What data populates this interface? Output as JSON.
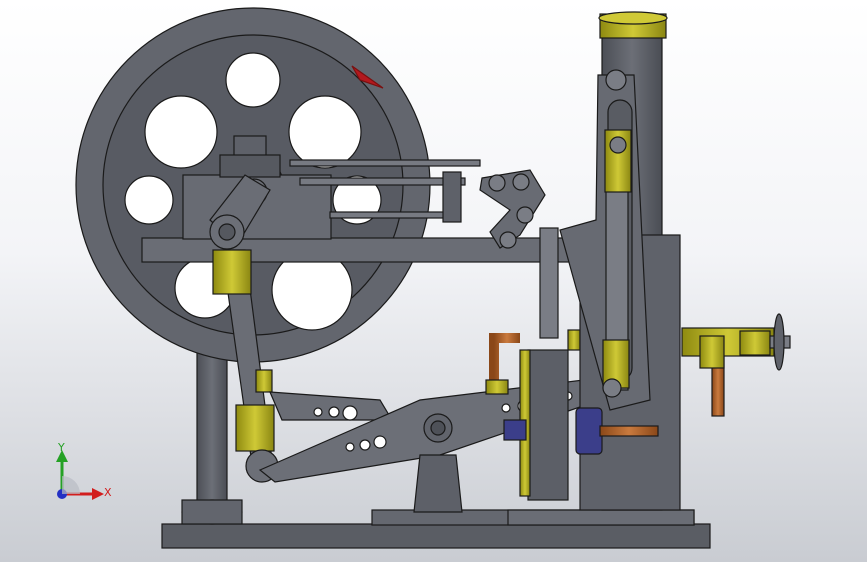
{
  "viewport": {
    "background_top": "#ffffff",
    "background_bottom": "#c9ccd2"
  },
  "model": {
    "description_parts": [
      "flywheel",
      "cylinder",
      "piston-rod",
      "walking-beam",
      "connecting-rod",
      "column",
      "base-plate",
      "pump-column",
      "valve-assembly",
      "steam-pipe",
      "handwheel",
      "rotation-arrow"
    ],
    "colors": {
      "steel": "#5d6068",
      "steel_dark": "#2b2d33",
      "steel_light": "#8a8d95",
      "brass": "#b9b321",
      "copper": "#b5652a",
      "blue_part": "#3b3e8a",
      "red_arrow": "#b3191e",
      "outline": "#1a1a1a"
    }
  },
  "triad": {
    "x_label": "X",
    "y_label": "Y",
    "x_color": "#d21d1d",
    "y_color": "#25a125",
    "z_color": "#2430c4"
  }
}
